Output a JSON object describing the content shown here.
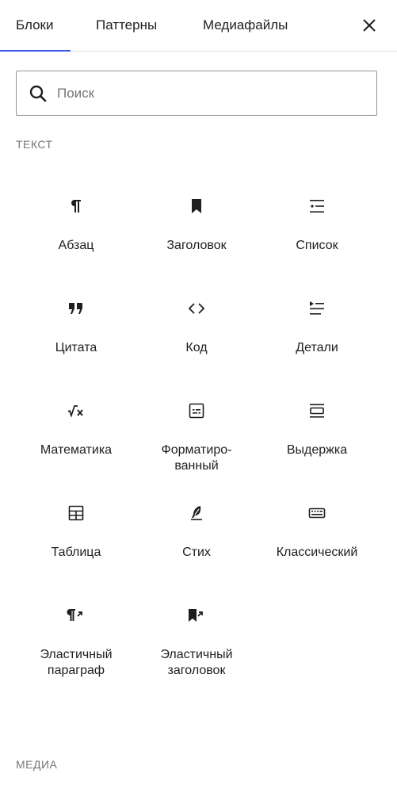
{
  "tabs": [
    {
      "label": "Блоки",
      "active": true
    },
    {
      "label": "Паттерны",
      "active": false
    },
    {
      "label": "Медиафайлы",
      "active": false
    }
  ],
  "close": {
    "icon": "close-icon"
  },
  "search": {
    "placeholder": "Поиск",
    "value": "",
    "icon": "search-icon"
  },
  "sections": {
    "text": "Текст",
    "media": "Медиа"
  },
  "blocks": [
    {
      "label": "Абзац",
      "icon": "paragraph-icon"
    },
    {
      "label": "Заголовок",
      "icon": "heading-bookmark-icon"
    },
    {
      "label": "Список",
      "icon": "list-icon"
    },
    {
      "label": "Цитата",
      "icon": "quote-icon"
    },
    {
      "label": "Код",
      "icon": "code-icon"
    },
    {
      "label": "Детали",
      "icon": "details-icon"
    },
    {
      "label": "Математика",
      "icon": "math-icon"
    },
    {
      "label": "Форматиро-\nванный",
      "icon": "preformatted-icon"
    },
    {
      "label": "Выдержка",
      "icon": "pullquote-icon"
    },
    {
      "label": "Таблица",
      "icon": "table-icon"
    },
    {
      "label": "Стих",
      "icon": "verse-feather-icon"
    },
    {
      "label": "Классический",
      "icon": "keyboard-icon"
    },
    {
      "label": "Эластичный\nпараграф",
      "icon": "fluid-paragraph-icon"
    },
    {
      "label": "Эластичный\nзаголовок",
      "icon": "fluid-heading-icon"
    }
  ],
  "colors": {
    "accent": "#3858e9",
    "text": "#1e1e1e",
    "muted": "#757575",
    "border": "#949494"
  }
}
